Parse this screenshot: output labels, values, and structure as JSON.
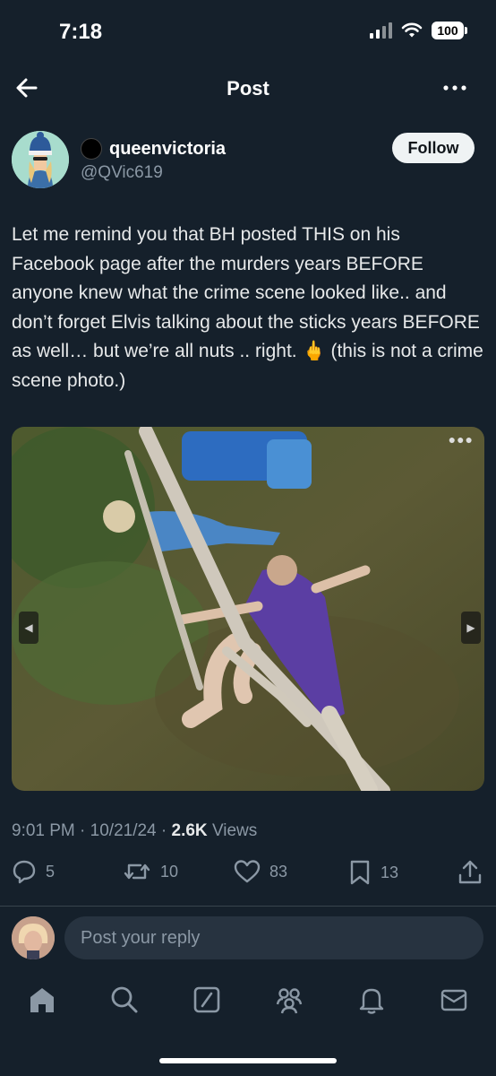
{
  "status_bar": {
    "time": "7:18",
    "battery": "100"
  },
  "nav": {
    "title": "Post",
    "back_icon": "back-arrow-icon",
    "more_icon": "more-icon"
  },
  "author": {
    "display_name": "queenvictoria",
    "handle": "@QVic619"
  },
  "follow_label": "Follow",
  "post": {
    "text": "Let me remind you that BH posted THIS on his Facebook page after the murders years BEFORE anyone knew what the crime scene looked like.. and don’t forget Elvis talking about the sticks years BEFORE as well… but we’re all nuts .. right. 🖕 (this is not a crime scene photo.)"
  },
  "meta": {
    "time": "9:01 PM",
    "date": "10/21/24",
    "views_count": "2.6K",
    "views_label": "Views"
  },
  "actions": {
    "replies": "5",
    "reposts": "10",
    "likes": "83",
    "bookmarks": "13"
  },
  "reply": {
    "placeholder": "Post your reply"
  },
  "tabs": [
    "home-icon",
    "search-icon",
    "grok-icon",
    "communities-icon",
    "notifications-icon",
    "messages-icon"
  ],
  "colors": {
    "background": "#15202b",
    "text": "#e7e9ea",
    "muted": "#8b98a5",
    "follow_bg": "#eff3f4"
  }
}
